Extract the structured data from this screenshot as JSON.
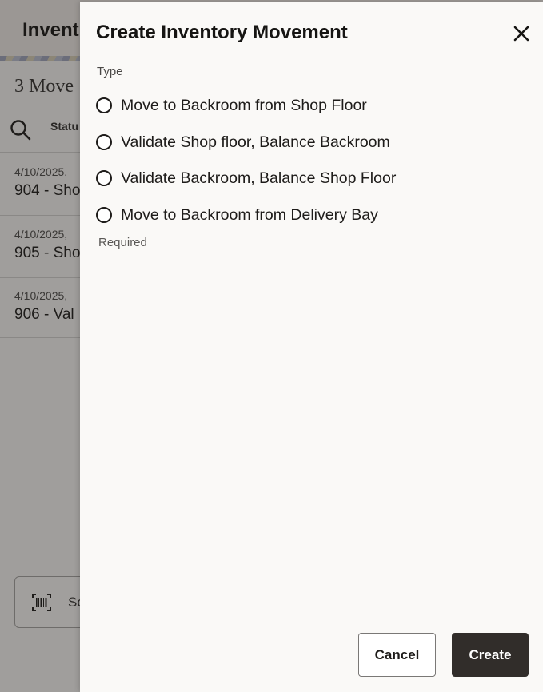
{
  "background": {
    "header_title": "Invent",
    "count_text": "3 Move",
    "status_label": "Statu",
    "rows": [
      {
        "date": "4/10/2025,",
        "title": "904 - Sho"
      },
      {
        "date": "4/10/2025,",
        "title": "905 - Sho"
      },
      {
        "date": "4/10/2025,",
        "title": "906 - Val"
      }
    ],
    "scan_label": "Sc",
    "icons": {
      "search": "search-icon",
      "barcode": "barcode-icon"
    }
  },
  "drawer": {
    "title": "Create Inventory Movement",
    "close_icon": "close-icon",
    "type_label": "Type",
    "options": [
      {
        "label": "Move to Backroom from Shop Floor",
        "selected": false
      },
      {
        "label": "Validate Shop floor, Balance Backroom",
        "selected": false
      },
      {
        "label": "Validate Backroom, Balance Shop Floor",
        "selected": false
      },
      {
        "label": "Move to Backroom from Delivery Bay",
        "selected": false
      }
    ],
    "helper_text": "Required",
    "cancel_label": "Cancel",
    "create_label": "Create"
  },
  "colors": {
    "primary_button": "#312d2a",
    "drawer_bg": "#faf9f7",
    "overlay_bg": "#a09e9c"
  }
}
